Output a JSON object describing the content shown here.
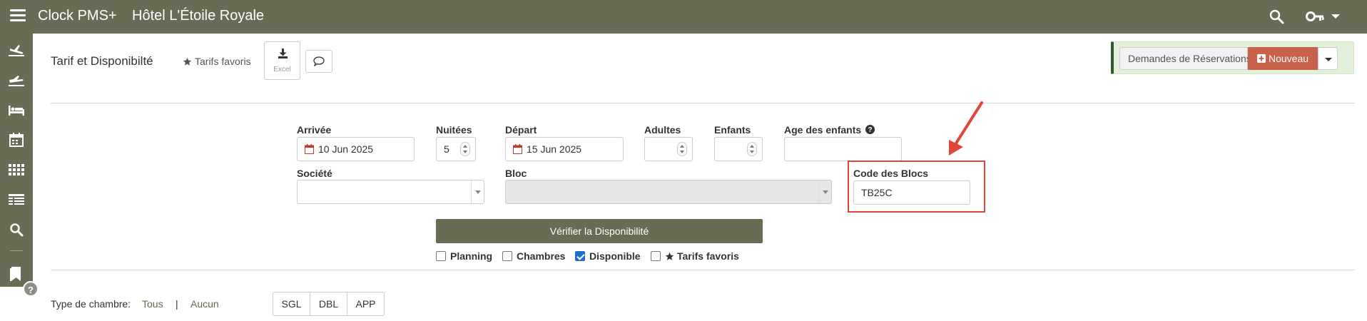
{
  "topbar": {
    "app_title": "Clock PMS+",
    "hotel_name": "Hôtel L'Étoile Royale",
    "icons": [
      "menu-icon",
      "search-icon",
      "key-icon",
      "caret-down-icon"
    ]
  },
  "sidebar": {
    "icons": [
      "arrivals-icon",
      "departures-icon",
      "bed-icon",
      "calendar-icon",
      "grid-icon",
      "table-icon",
      "search-icon",
      "bookmark-icon",
      "help-icon"
    ],
    "help_label": "?"
  },
  "header": {
    "title": "Tarif et Disponibilté",
    "favorites_label": "Tarifs favoris",
    "excel_label": "Excel",
    "requests_label": "Demandes de Réservations :",
    "new_button_label": "Nouveau"
  },
  "form": {
    "arrival": {
      "label": "Arrivée",
      "value": "10 Jun 2025"
    },
    "nights": {
      "label": "Nuitées",
      "value": "5"
    },
    "departure": {
      "label": "Départ",
      "value": "15 Jun 2025"
    },
    "adults": {
      "label": "Adultes",
      "value": ""
    },
    "children": {
      "label": "Enfants",
      "value": ""
    },
    "children_ages": {
      "label": "Age des enfants",
      "value": ""
    },
    "company": {
      "label": "Société",
      "value": ""
    },
    "block": {
      "label": "Bloc",
      "value": ""
    },
    "block_code": {
      "label": "Code des Blocs",
      "value": "TB25C"
    },
    "verify_button": "Vérifier la Disponibilité"
  },
  "options": [
    {
      "label": "Planning",
      "checked": false
    },
    {
      "label": "Chambres",
      "checked": false
    },
    {
      "label": "Disponible",
      "checked": true
    },
    {
      "label": "Tarifs favoris",
      "checked": false,
      "star": true
    }
  ],
  "room_types": {
    "label": "Type de chambre:",
    "all_link": "Tous",
    "separator": "|",
    "none_link": "Aucun",
    "buttons": [
      "SGL",
      "DBL",
      "APP"
    ]
  },
  "colors": {
    "bar": "#676d55",
    "accent_new": "#c9624a",
    "highlight": "#e0463a",
    "checkbox": "#1f6fd1"
  }
}
